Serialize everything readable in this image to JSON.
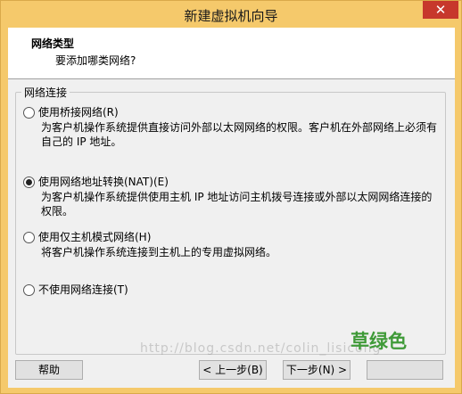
{
  "window": {
    "title": "新建虚拟机向导",
    "close_glyph": "✕"
  },
  "header": {
    "title": "网络类型",
    "subtitle": "要添加哪类网络?"
  },
  "group": {
    "legend": "网络连接",
    "options": [
      {
        "label": "使用桥接网络(R)",
        "checked": false,
        "description": "为客户机操作系统提供直接访问外部以太网网络的权限。客户机在外部网络上必须有自己的 IP 地址。"
      },
      {
        "label": "使用网络地址转换(NAT)(E)",
        "checked": true,
        "description": "为客户机操作系统提供使用主机 IP 地址访问主机拨号连接或外部以太网网络连接的权限。"
      },
      {
        "label": "使用仅主机模式网络(H)",
        "checked": false,
        "description": "将客户机操作系统连接到主机上的专用虚拟网络。"
      },
      {
        "label": "不使用网络连接(T)",
        "checked": false,
        "description": ""
      }
    ]
  },
  "buttons": {
    "help": "帮助",
    "back": "< 上一步(B)",
    "next": "下一步(N) >",
    "finish": ""
  },
  "watermark": "http://blog.csdn.net/colin_lisicong",
  "overlay_text": "草绿色",
  "colors": {
    "frame": "#f5c96b",
    "close": "#c7382c",
    "overlay": "#3f9a38"
  }
}
